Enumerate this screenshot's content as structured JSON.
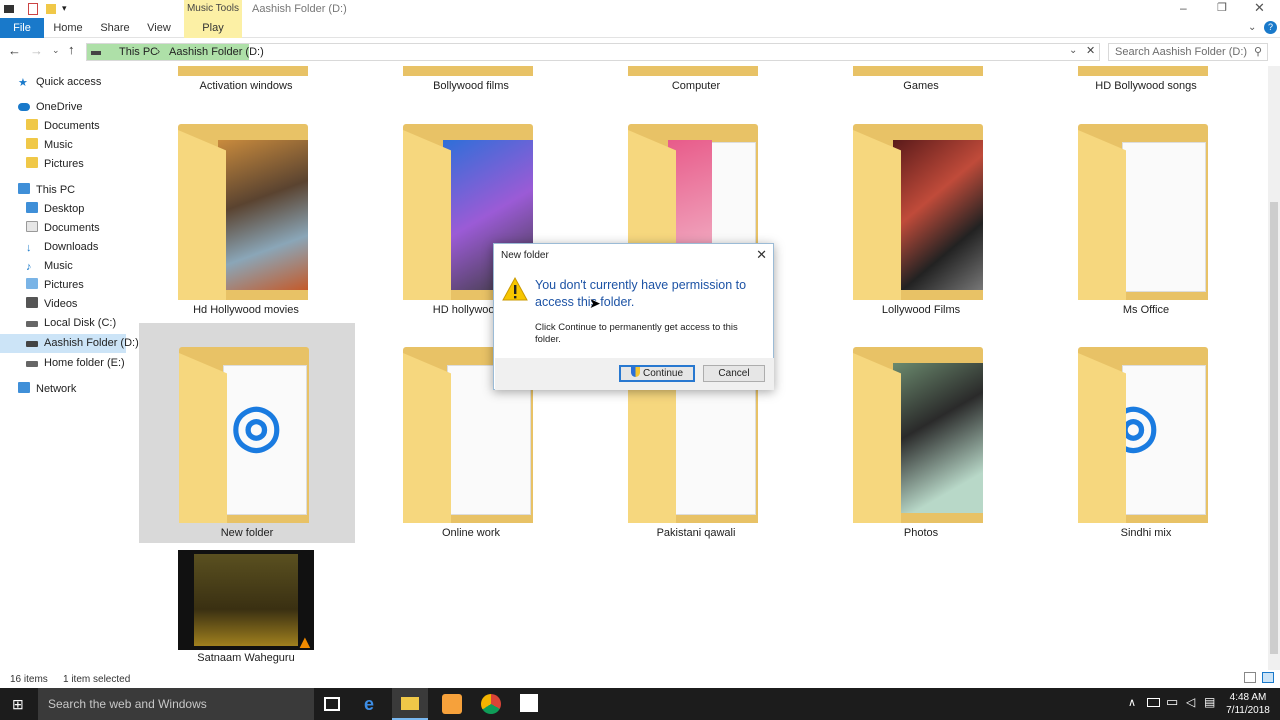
{
  "window": {
    "title": "Aashish Folder (D:)",
    "music_tools": "Music Tools",
    "tabs": [
      "File",
      "Home",
      "Share",
      "View",
      "Play"
    ]
  },
  "address": {
    "crumbs": [
      "This PC",
      "Aashish Folder (D:)"
    ],
    "search_placeholder": "Search Aashish Folder (D:)"
  },
  "nav": {
    "items": [
      {
        "label": "Quick access"
      },
      {
        "label": "OneDrive"
      },
      {
        "label": "Documents"
      },
      {
        "label": "Music"
      },
      {
        "label": "Pictures"
      },
      {
        "label": "This PC"
      },
      {
        "label": "Desktop"
      },
      {
        "label": "Documents"
      },
      {
        "label": "Downloads"
      },
      {
        "label": "Music"
      },
      {
        "label": "Pictures"
      },
      {
        "label": "Videos"
      },
      {
        "label": "Local Disk (C:)"
      },
      {
        "label": "Aashish Folder (D:)"
      },
      {
        "label": "Home folder (E:)"
      },
      {
        "label": "Network"
      }
    ]
  },
  "folders": {
    "top_row": [
      "Activation windows",
      "Bollywood films",
      "Computer",
      "Games",
      "HD Bollywood songs"
    ],
    "row2": [
      "Hd Hollywood movies",
      "HD hollywood s",
      "",
      "Lollywood Films",
      "Ms Office"
    ],
    "row3": [
      "New folder",
      "Online work",
      "Pakistani qawali",
      "Photos",
      "Sindhi mix"
    ],
    "row4": [
      "Satnaam Waheguru"
    ]
  },
  "status": {
    "items": "16 items",
    "selected": "1 item selected"
  },
  "taskbar": {
    "search": "Search the web and Windows",
    "time": "4:48 AM",
    "date": "7/11/2018"
  },
  "dialog": {
    "title": "New folder",
    "main": "You don't currently have permission to access this folder.",
    "sub": "Click Continue to permanently get access to this folder.",
    "continue": "Continue",
    "cancel": "Cancel"
  },
  "colors": {
    "accent": "#1979ca",
    "folder": "#e8c266",
    "dialog_text": "#1d53a5"
  }
}
